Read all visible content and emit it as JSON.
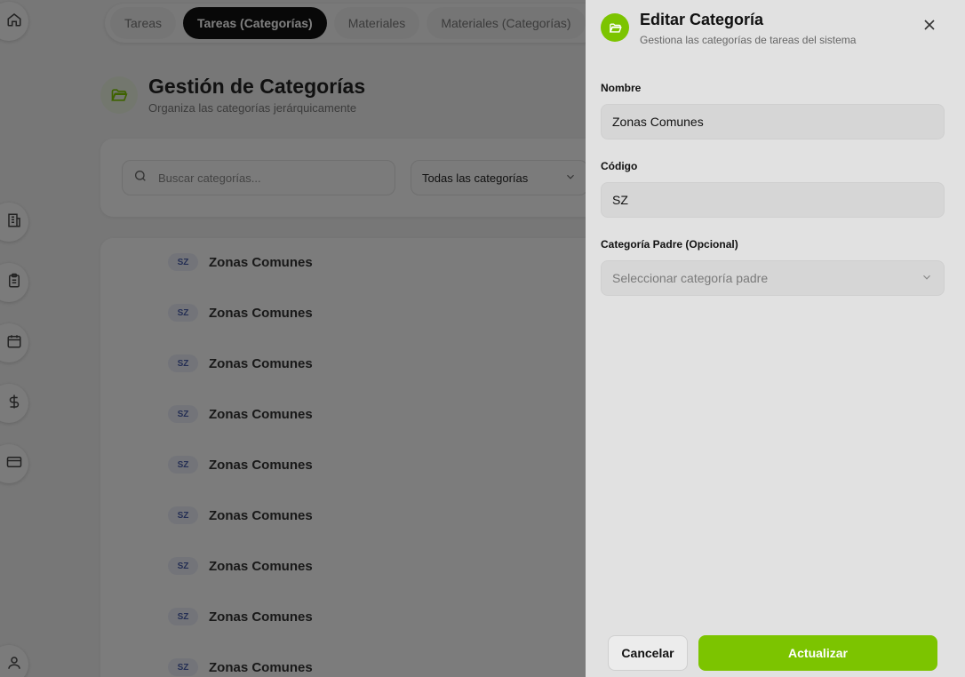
{
  "tabs": [
    "Tareas",
    "Tareas (Categorías)",
    "Materiales",
    "Materiales (Categorías)"
  ],
  "active_tab": "Tareas (Categorías)",
  "page": {
    "title": "Gestión de Categorías",
    "subtitle": "Organiza las categorías jerárquicamente"
  },
  "filters": {
    "search_placeholder": "Buscar categorías...",
    "category_filter": "Todas las categorías"
  },
  "list": {
    "rows": [
      {
        "code": "SZ",
        "name": "Zonas Comunes"
      },
      {
        "code": "SZ",
        "name": "Zonas Comunes"
      },
      {
        "code": "SZ",
        "name": "Zonas Comunes"
      },
      {
        "code": "SZ",
        "name": "Zonas Comunes"
      },
      {
        "code": "SZ",
        "name": "Zonas Comunes"
      },
      {
        "code": "SZ",
        "name": "Zonas Comunes"
      },
      {
        "code": "SZ",
        "name": "Zonas Comunes"
      },
      {
        "code": "SZ",
        "name": "Zonas Comunes"
      },
      {
        "code": "SZ",
        "name": "Zonas Comunes"
      }
    ]
  },
  "sidebar": {
    "icons": [
      "home-icon",
      "building-icon",
      "clipboard-icon",
      "calendar-icon",
      "dollar-icon",
      "credit-card-icon",
      "user-icon"
    ]
  },
  "drawer": {
    "title": "Editar Categoría",
    "subtitle": "Gestiona las categorías de tareas del sistema",
    "name_label": "Nombre",
    "name_value": "Zonas Comunes",
    "code_label": "Código",
    "code_value": "SZ",
    "parent_label": "Categoría Padre (Opcional)",
    "parent_placeholder": "Seleccionar categoría padre",
    "cancel_label": "Cancelar",
    "update_label": "Actualizar"
  },
  "colors": {
    "accent": "#7cc400",
    "active_tab": "#111111",
    "badge_bg": "#e6e9f3",
    "badge_text": "#4a5ea8"
  }
}
